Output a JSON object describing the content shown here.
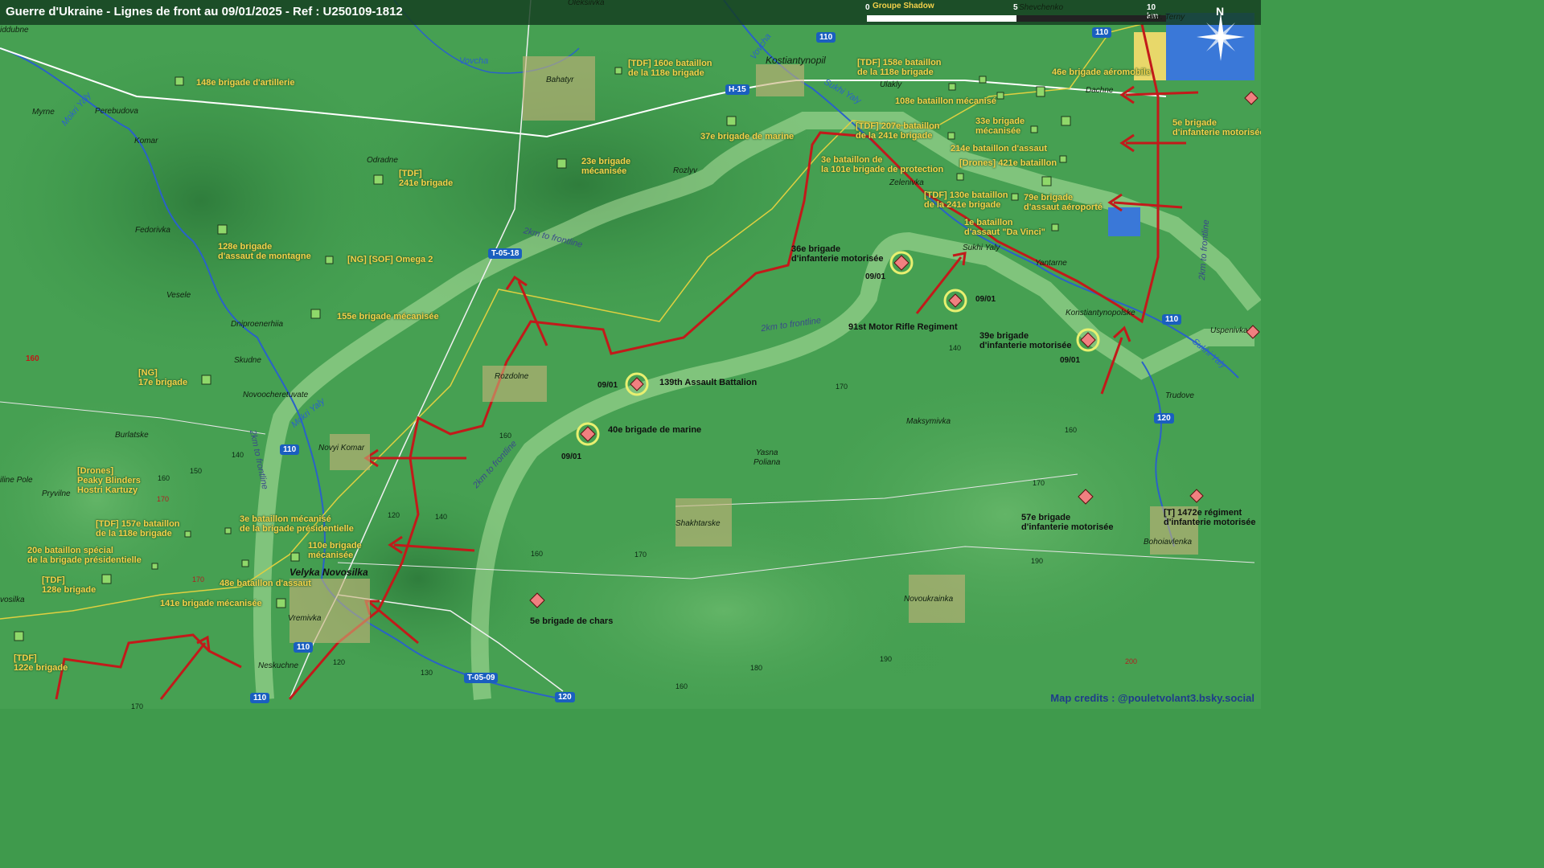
{
  "header": {
    "title": "Guerre d'Ukraine - Lignes de front au 09/01/2025 - Ref : U250109-1812",
    "scale": {
      "zero": "0",
      "mid": "5",
      "max": "10 km"
    },
    "north": "N",
    "layer_label": "Groupe Shadow"
  },
  "colors": {
    "ukr_unit_label": "#f3d14a",
    "front_line": "#c21a1a",
    "ukr_control_line": "#e0d040",
    "terrain": "#3f9a4c"
  },
  "roads": {
    "h15": "H-15",
    "t0518": "T-05-18",
    "t0509": "T-05-09",
    "r110a": "110",
    "r110b": "110",
    "r110c": "110",
    "r110d": "110",
    "r110e": "110",
    "r110f": "110",
    "r120a": "120",
    "r120b": "120",
    "r160": "160"
  },
  "rivers": {
    "vovcha": "Vovcha",
    "vovcha2": "Vovcha",
    "mokri_yaly": "Mokri Yaly",
    "mokri_yaly2": "Mokri Yaly",
    "sukhi_yaly": "Sukhi Yaly",
    "sukhi_yaly2": "Sukhi Yaly",
    "sukhi_yaly3": "Sukhi Yaly"
  },
  "places": {
    "iddubne": "iddubne",
    "oleksiivka": "Oleksiivka",
    "shevchenko": "Shevchenko",
    "staryi_terny": "Star. Terny",
    "myrne": "Myrne",
    "perebudova": "Perebudova",
    "komar": "Komar",
    "bahatyr": "Bahatyr",
    "kostiantynopil": "Kostiantynopil",
    "ulakly": "Ulakly",
    "dachne": "Dachne",
    "odradne": "Odradne",
    "rozlyv": "Rozlyv",
    "zelenivka": "Zelenivka",
    "fedorivka": "Fedorivka",
    "vesele": "Vesele",
    "sukhi_yaly_town": "Sukhi Yaly",
    "yantarne": "Yantarne",
    "dniproenerhiia": "Dniproenerhiia",
    "konstiantynopolske": "Konstiantynopolske",
    "uspenivka": "Uspenivka",
    "skudne": "Skudne",
    "rozdolne": "Rozdolne",
    "novoocheretuvate": "Novoocheretuvate",
    "trudove": "Trudove",
    "burlatske": "Burlatske",
    "novyi_komar": "Novyi Komar",
    "maksymivka": "Maksymivka",
    "yasna_poliana": "Yasna\nPoliana",
    "iline_pole": "iline Pole",
    "pryvilne": "Pryvilne",
    "shakhtarske": "Shakhtarske",
    "bohoiavlenka": "Bohoiavlenka",
    "velyka_novosilka": "Velyka Novosilka",
    "vremivka": "Vremivka",
    "novoukrainka": "Novoukrainka",
    "neskuchne": "Neskuchne",
    "vosilka": "vosilka"
  },
  "frontline_labels": {
    "a": "2km to frontline",
    "b": "2km to frontline",
    "c": "2km to frontline",
    "d": "2km to frontline",
    "e": "2km to frontline"
  },
  "altitudes": [
    "140",
    "160",
    "150",
    "170",
    "120",
    "140",
    "160",
    "170",
    "160",
    "170",
    "180",
    "190",
    "170",
    "160",
    "140",
    "130",
    "120",
    "200",
    "190",
    "170",
    "160",
    "170"
  ],
  "ukr_units": {
    "u1": "148e brigade d'artillerie",
    "u2": "[TDF] 160e bataillon\nde la 118e brigade",
    "u3": "[TDF] 158e bataillon\nde la 118e brigade",
    "u4": "46e brigade aéromobile",
    "u5": "108e bataillon mécanisé",
    "u6": "33e brigade\nmécanisée",
    "u7": "5e brigade\nd'infanterie motorisée",
    "u8": "37e brigade de marine",
    "u9": "[TDF] 207e bataillon\nde la 241e brigade",
    "u10": "214e bataillon d'assaut",
    "u11": "23e brigade\nmécanisée",
    "u12": "[TDF]\n241e brigade",
    "u13": "3e bataillon de\nla 101e brigade de protection",
    "u14": "[Drones] 421e bataillon",
    "u15": "[TDF] 130e bataillon\nde la 241e brigade",
    "u16": "79e brigade\nd'assaut aéroporté",
    "u17": "1e bataillon\nd'assaut \"Da Vinci\"",
    "u18": "128e brigade\nd'assaut de montagne",
    "u19": "[NG] [SOF] Omega 2",
    "u20": "155e brigade mécanisée",
    "u21": "[NG]\n17e brigade",
    "u22": "[Drones]\nPeaky Blinders\nHostri Kartuzy",
    "u23": "[TDF] 157e bataillon\nde la 118e brigade",
    "u24": "3e bataillon mécanisé\nde la brigade présidentielle",
    "u25": "20e bataillon spécial\nde la brigade présidentielle",
    "u26": "110e brigade\nmécanisée",
    "u27": "[TDF]\n128e brigade",
    "u28": "48e bataillon d'assaut",
    "u29": "141e brigade mécanisée",
    "u30": "[TDF]\n122e brigade"
  },
  "ru_units": {
    "r1": "36e brigade\nd'infanterie motorisée",
    "r2": "91st Motor Rifle Regiment",
    "r3": "39e brigade\nd'infanterie motorisée",
    "r4": "139th Assault Battalion",
    "r5": "40e brigade de marine",
    "r6": "5e brigade de chars",
    "r7": "57e brigade\nd'infanterie motorisée",
    "r8": "[T] 1472e régiment\nd'infanterie motorisée"
  },
  "dates": {
    "d1": "09/01",
    "d2": "09/01",
    "d3": "09/01",
    "d4": "09/01",
    "d5": "09/01"
  },
  "credits": "Map credits : @pouletvolant3.bsky.social"
}
